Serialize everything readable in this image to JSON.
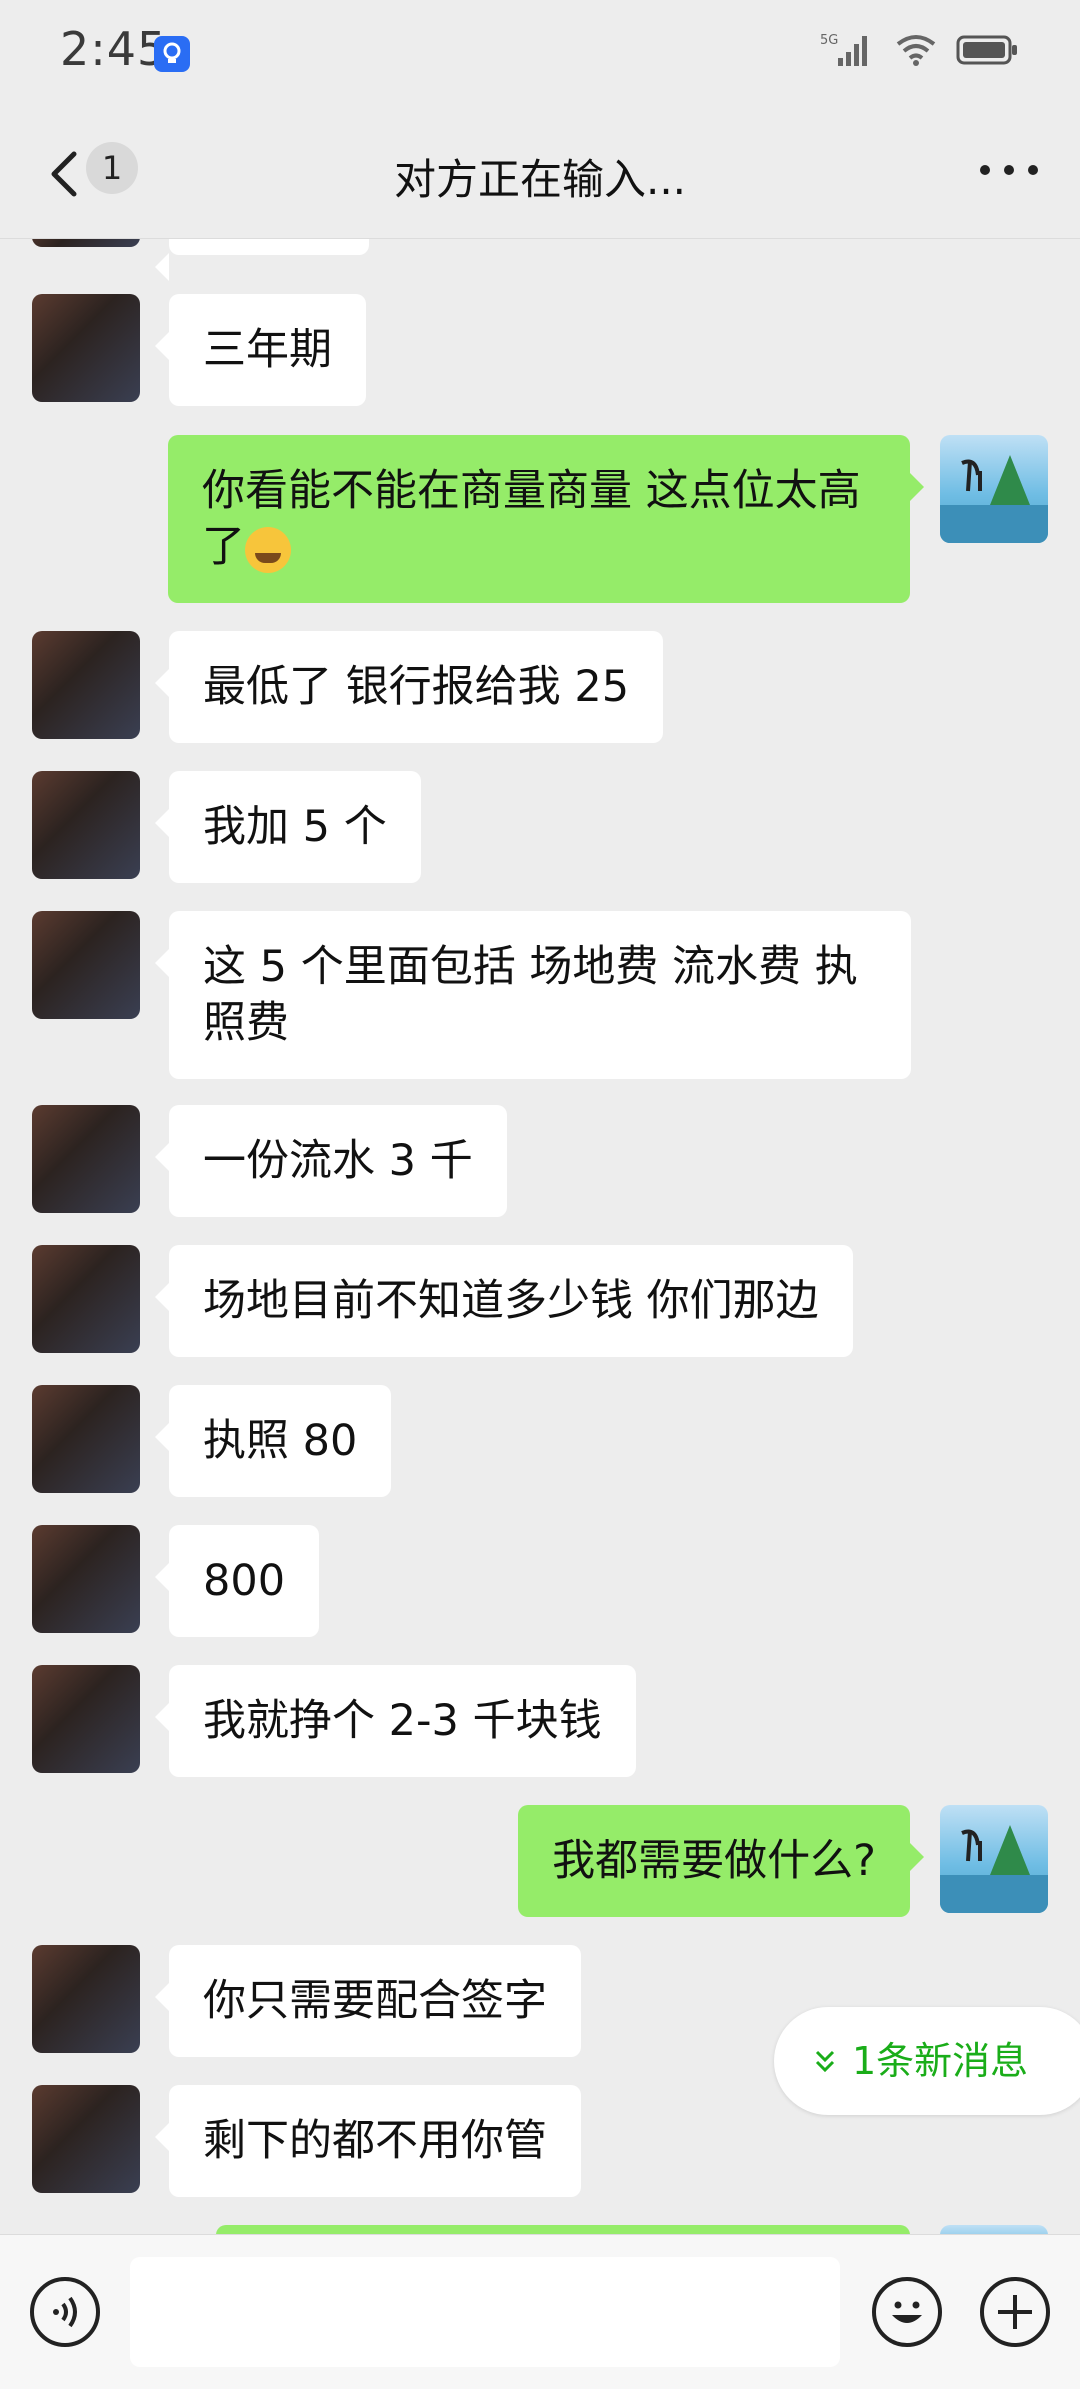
{
  "status_bar": {
    "time": "2:45",
    "network": "5G"
  },
  "header": {
    "unread_count": "1",
    "title": "对方正在输入..."
  },
  "messages": [
    {
      "side": "left",
      "text": "三年期"
    },
    {
      "side": "right",
      "text": "你看能不能在商量商量  这点位太高了",
      "emoji": "crying-face"
    },
    {
      "side": "left",
      "text": "最低了 银行报给我 25"
    },
    {
      "side": "left",
      "text": "我加 5 个"
    },
    {
      "side": "left",
      "text": "这 5 个里面包括 场地费 流水费 执照费"
    },
    {
      "side": "left",
      "text": "一份流水 3 千"
    },
    {
      "side": "left",
      "text": "场地目前不知道多少钱 你们那边"
    },
    {
      "side": "left",
      "text": "执照 80"
    },
    {
      "side": "left",
      "text": "800"
    },
    {
      "side": "left",
      "text": "我就挣个 2-3 千块钱"
    },
    {
      "side": "right",
      "text": "我都需要做什么?"
    },
    {
      "side": "left",
      "text": "你只需要配合签字"
    },
    {
      "side": "left",
      "text": "剩下的都不用你管"
    }
  ],
  "new_message_pill": "1条新消息",
  "icons": {
    "back": "chevron-left-icon",
    "more": "more-dots-icon",
    "voice": "voice-icon",
    "emoji": "emoji-icon",
    "plus": "plus-icon"
  }
}
